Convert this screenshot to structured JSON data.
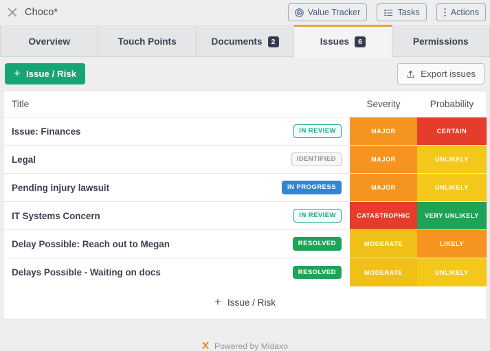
{
  "header": {
    "close_icon": "close-x-icon",
    "deal_name": "Choco*",
    "buttons": [
      {
        "label": "Value Tracker",
        "icon": "target-icon"
      },
      {
        "label": "Tasks",
        "icon": "task-list-icon"
      },
      {
        "label": "Actions",
        "icon": "vertical-dots-icon"
      }
    ]
  },
  "tabs": [
    {
      "label": "Overview",
      "badge": "",
      "active": false
    },
    {
      "label": "Touch Points",
      "badge": "",
      "active": false
    },
    {
      "label": "Documents",
      "badge": "2",
      "active": false
    },
    {
      "label": "Issues",
      "badge": "6",
      "active": true
    },
    {
      "label": "Permissions",
      "badge": "",
      "active": false
    }
  ],
  "toolbar": {
    "add_label": "Issue / Risk",
    "add_icon": "plus-icon",
    "export_label": "Export issues",
    "export_icon": "upload-icon"
  },
  "table": {
    "columns": {
      "title": "Title",
      "severity": "Severity",
      "probability": "Probability"
    },
    "rows": [
      {
        "title": "Issue: Finances",
        "status": "IN REVIEW",
        "status_style": "pill-review",
        "severity": "MAJOR",
        "severity_color": "#f5951f",
        "probability": "CERTAIN",
        "probability_color": "#e53c2b"
      },
      {
        "title": "Legal",
        "status": "IDENTIFIED",
        "status_style": "pill-identified",
        "severity": "MAJOR",
        "severity_color": "#f5951f",
        "probability": "UNLIKELY",
        "probability_color": "#f3c81b"
      },
      {
        "title": "Pending injury lawsuit",
        "status": "IN PROGRESS",
        "status_style": "pill-progress",
        "severity": "MAJOR",
        "severity_color": "#f5951f",
        "probability": "UNLIKELY",
        "probability_color": "#f3c81b"
      },
      {
        "title": "IT Systems Concern",
        "status": "IN REVIEW",
        "status_style": "pill-review",
        "severity": "CATASTROPHIC",
        "severity_color": "#e53c2b",
        "probability": "VERY UNLIKELY",
        "probability_color": "#1fa356"
      },
      {
        "title": "Delay Possible: Reach out to Megan",
        "status": "RESOLVED",
        "status_style": "pill-resolved",
        "severity": "MODERATE",
        "severity_color": "#f0c018",
        "probability": "LIKELY",
        "probability_color": "#f5951f"
      },
      {
        "title": "Delays Possible - Waiting on docs",
        "status": "RESOLVED",
        "status_style": "pill-resolved",
        "severity": "MODERATE",
        "severity_color": "#f0c018",
        "probability": "UNLIKELY",
        "probability_color": "#f3c81b"
      }
    ],
    "footer_add_label": "Issue / Risk",
    "footer_add_icon": "plus-icon"
  },
  "footer": {
    "brand_mark": "X",
    "brand_text": "Powered by Midaxo"
  }
}
